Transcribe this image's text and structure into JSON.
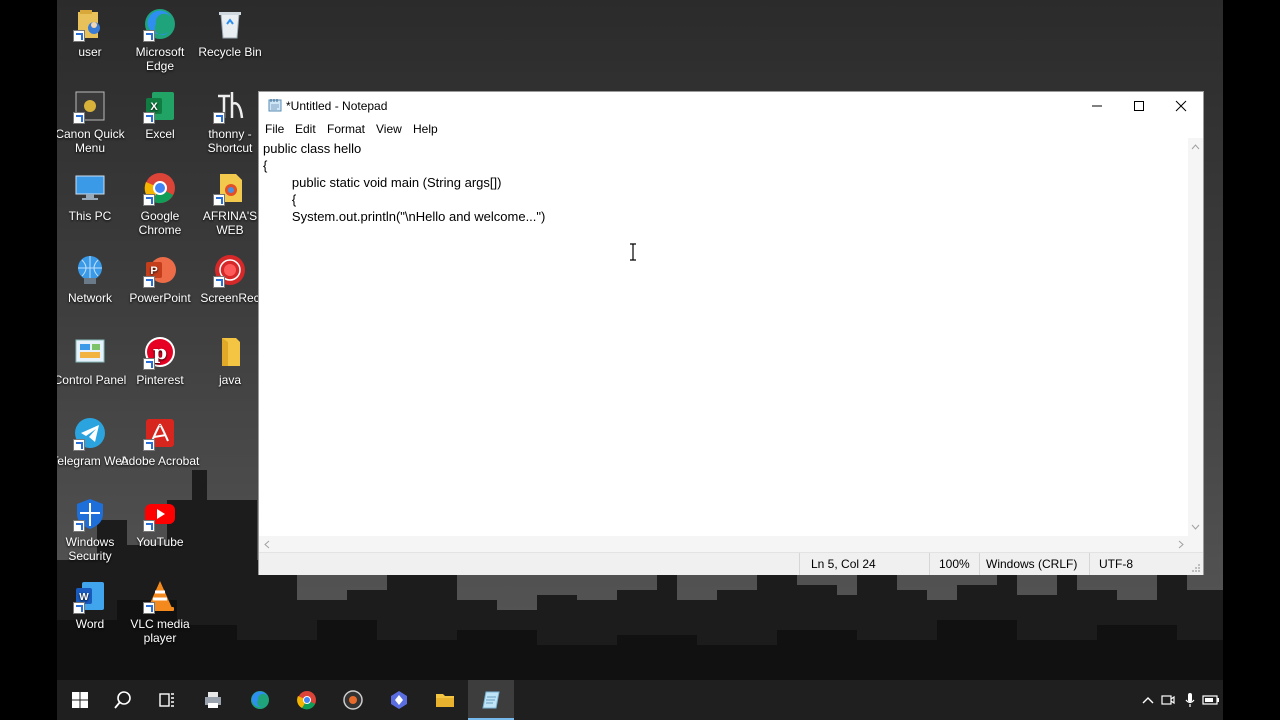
{
  "desktop": {
    "icons": [
      {
        "label": "user",
        "name": "desktop-icon-user",
        "icon": "user-folder-icon"
      },
      {
        "label": "Microsoft Edge",
        "name": "desktop-icon-edge",
        "icon": "edge-icon"
      },
      {
        "label": "Recycle Bin",
        "name": "desktop-icon-recycle-bin",
        "icon": "recycle-bin-icon"
      },
      {
        "label": "Canon Quick Menu",
        "name": "desktop-icon-canon",
        "icon": "canon-icon"
      },
      {
        "label": "Excel",
        "name": "desktop-icon-excel",
        "icon": "excel-icon"
      },
      {
        "label": "thonny - Shortcut",
        "name": "desktop-icon-thonny",
        "icon": "thonny-icon"
      },
      {
        "label": "This PC",
        "name": "desktop-icon-this-pc",
        "icon": "computer-icon"
      },
      {
        "label": "Google Chrome",
        "name": "desktop-icon-chrome",
        "icon": "chrome-icon"
      },
      {
        "label": "AFRINA'S WEB",
        "name": "desktop-icon-afrinas-web",
        "icon": "html-file-icon"
      },
      {
        "label": "Network",
        "name": "desktop-icon-network",
        "icon": "network-icon"
      },
      {
        "label": "PowerPoint",
        "name": "desktop-icon-powerpoint",
        "icon": "powerpoint-icon"
      },
      {
        "label": "ScreenRec",
        "name": "desktop-icon-screenrec",
        "icon": "record-icon"
      },
      {
        "label": "Control Panel",
        "name": "desktop-icon-control-panel",
        "icon": "control-panel-icon"
      },
      {
        "label": "Pinterest",
        "name": "desktop-icon-pinterest",
        "icon": "pinterest-icon"
      },
      {
        "label": "java",
        "name": "desktop-icon-java-folder",
        "icon": "folder-icon"
      },
      {
        "label": "Telegram Web",
        "name": "desktop-icon-telegram",
        "icon": "telegram-icon"
      },
      {
        "label": "Adobe Acrobat",
        "name": "desktop-icon-acrobat",
        "icon": "acrobat-icon"
      },
      {
        "label": "Windows Security",
        "name": "desktop-icon-windows-security",
        "icon": "shield-icon"
      },
      {
        "label": "YouTube",
        "name": "desktop-icon-youtube",
        "icon": "youtube-icon"
      },
      {
        "label": "Word",
        "name": "desktop-icon-word",
        "icon": "word-icon"
      },
      {
        "label": "VLC media player",
        "name": "desktop-icon-vlc",
        "icon": "vlc-icon"
      }
    ]
  },
  "notepad": {
    "title": "*Untitled - Notepad",
    "menu": [
      "File",
      "Edit",
      "Format",
      "View",
      "Help"
    ],
    "content": "public class hello\n{\n\tpublic static void main (String args[])\n\t{\n\tSystem.out.println(\"\\nHello and welcome...\")",
    "status": {
      "position": "Ln 5, Col 24",
      "zoom": "100%",
      "line_ending": "Windows (CRLF)",
      "encoding": "UTF-8"
    }
  },
  "taskbar": {
    "items": [
      "start-icon",
      "search-icon",
      "task-view-icon",
      "printer-icon",
      "edge-icon",
      "chrome-icon",
      "media-icon",
      "app-icon",
      "file-explorer-icon",
      "notepad-icon"
    ]
  }
}
